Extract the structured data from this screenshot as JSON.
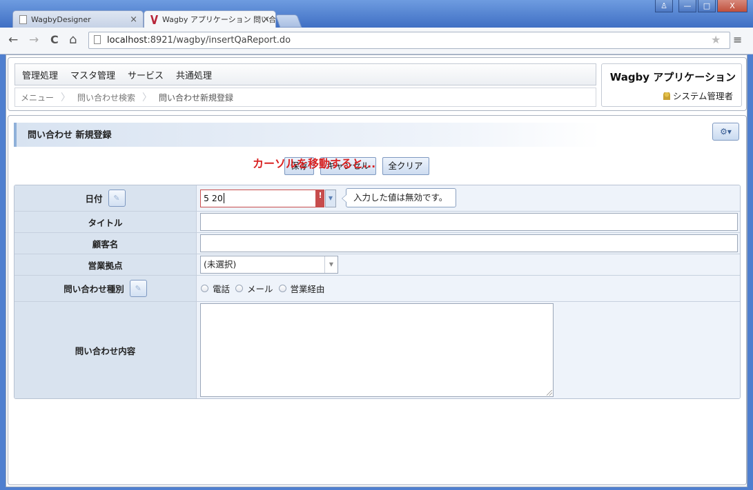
{
  "browser": {
    "tabs": [
      {
        "title": "WagbyDesigner",
        "close": "×"
      },
      {
        "title": "Wagby アプリケーション 問い合",
        "close": "×"
      }
    ],
    "window_buttons": {
      "user": "♙",
      "minimize": "—",
      "maximize": "□",
      "close": "X"
    },
    "nav": {
      "back": "←",
      "forward": "→",
      "reload": "C",
      "home": "⌂"
    },
    "url_host": "localhost",
    "url_rest": ":8921/wagby/insertQaReport.do",
    "star": "★",
    "menu": "≡"
  },
  "header": {
    "menu_items": [
      "管理処理",
      "マスタ管理",
      "サービス",
      "共通処理"
    ],
    "breadcrumb": [
      "メニュー",
      "問い合わせ検索",
      "問い合わせ新規登録"
    ],
    "crumb_sep": "〉",
    "app_title": "Wagby アプリケーション",
    "user_name": "システム管理者"
  },
  "content": {
    "section_title": "問い合わせ 新規登録",
    "gear": "⚙▾",
    "buttons": {
      "save": "保存",
      "cancel": "キャンセル",
      "clear": "全クリア"
    }
  },
  "form": {
    "date_label": "日付",
    "date_value": "5 20",
    "date_error_mark": "!",
    "date_arrow": "▼",
    "date_error_message": "入力した値は無効です。",
    "title_label": "タイトル",
    "customer_label": "顧客名",
    "office_label": "営業拠点",
    "office_selected": "(未選択)",
    "office_arrow": "▼",
    "inquiry_type_label": "問い合わせ種別",
    "inquiry_types": [
      "電話",
      "メール",
      "営業経由"
    ],
    "inquiry_content_label": "問い合わせ内容",
    "help_icon_glyph": "✎"
  },
  "annotation": "カーソルを移動すると..."
}
